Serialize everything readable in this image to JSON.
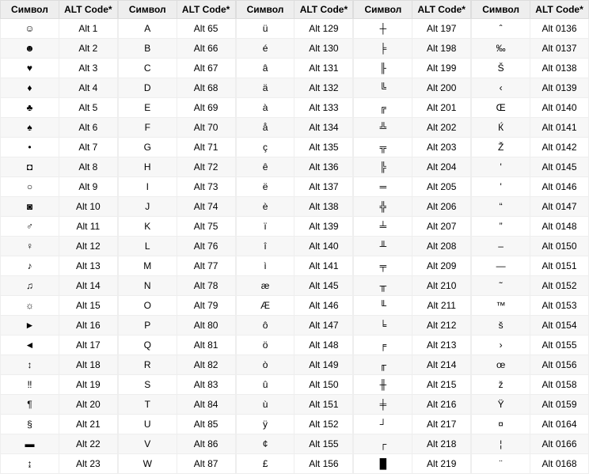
{
  "headers": {
    "symbol": "Символ",
    "code": "ALT Code*"
  },
  "columns": [
    [
      {
        "s": "☺",
        "c": "Alt 1"
      },
      {
        "s": "☻",
        "c": "Alt 2"
      },
      {
        "s": "♥",
        "c": "Alt 3"
      },
      {
        "s": "♦",
        "c": "Alt 4"
      },
      {
        "s": "♣",
        "c": "Alt 5"
      },
      {
        "s": "♠",
        "c": "Alt 6"
      },
      {
        "s": "•",
        "c": "Alt 7"
      },
      {
        "s": "◘",
        "c": "Alt 8"
      },
      {
        "s": "○",
        "c": "Alt 9"
      },
      {
        "s": "◙",
        "c": "Alt 10"
      },
      {
        "s": "♂",
        "c": "Alt 11"
      },
      {
        "s": "♀",
        "c": "Alt 12"
      },
      {
        "s": "♪",
        "c": "Alt 13"
      },
      {
        "s": "♫",
        "c": "Alt 14"
      },
      {
        "s": "☼",
        "c": "Alt 15"
      },
      {
        "s": "►",
        "c": "Alt 16"
      },
      {
        "s": "◄",
        "c": "Alt 17"
      },
      {
        "s": "↕",
        "c": "Alt 18"
      },
      {
        "s": "‼",
        "c": "Alt 19"
      },
      {
        "s": "¶",
        "c": "Alt 20"
      },
      {
        "s": "§",
        "c": "Alt 21"
      },
      {
        "s": "▬",
        "c": "Alt 22"
      },
      {
        "s": "↨",
        "c": "Alt 23"
      }
    ],
    [
      {
        "s": "A",
        "c": "Alt 65"
      },
      {
        "s": "B",
        "c": "Alt 66"
      },
      {
        "s": "C",
        "c": "Alt 67"
      },
      {
        "s": "D",
        "c": "Alt 68"
      },
      {
        "s": "E",
        "c": "Alt 69"
      },
      {
        "s": "F",
        "c": "Alt 70"
      },
      {
        "s": "G",
        "c": "Alt 71"
      },
      {
        "s": "H",
        "c": "Alt 72"
      },
      {
        "s": "I",
        "c": "Alt 73"
      },
      {
        "s": "J",
        "c": "Alt 74"
      },
      {
        "s": "K",
        "c": "Alt 75"
      },
      {
        "s": "L",
        "c": "Alt 76"
      },
      {
        "s": "M",
        "c": "Alt 77"
      },
      {
        "s": "N",
        "c": "Alt 78"
      },
      {
        "s": "O",
        "c": "Alt 79"
      },
      {
        "s": "P",
        "c": "Alt 80"
      },
      {
        "s": "Q",
        "c": "Alt 81"
      },
      {
        "s": "R",
        "c": "Alt 82"
      },
      {
        "s": "S",
        "c": "Alt 83"
      },
      {
        "s": "T",
        "c": "Alt 84"
      },
      {
        "s": "U",
        "c": "Alt 85"
      },
      {
        "s": "V",
        "c": "Alt 86"
      },
      {
        "s": "W",
        "c": "Alt 87"
      }
    ],
    [
      {
        "s": "ü",
        "c": "Alt 129"
      },
      {
        "s": "é",
        "c": "Alt 130"
      },
      {
        "s": "â",
        "c": "Alt 131"
      },
      {
        "s": "ä",
        "c": "Alt 132"
      },
      {
        "s": "à",
        "c": "Alt 133"
      },
      {
        "s": "å",
        "c": "Alt 134"
      },
      {
        "s": "ç",
        "c": "Alt 135"
      },
      {
        "s": "ê",
        "c": "Alt 136"
      },
      {
        "s": "ë",
        "c": "Alt 137"
      },
      {
        "s": "è",
        "c": "Alt 138"
      },
      {
        "s": "ï",
        "c": "Alt 139"
      },
      {
        "s": "î",
        "c": "Alt 140"
      },
      {
        "s": "ì",
        "c": "Alt 141"
      },
      {
        "s": "æ",
        "c": "Alt 145"
      },
      {
        "s": "Æ",
        "c": "Alt 146"
      },
      {
        "s": "ô",
        "c": "Alt 147"
      },
      {
        "s": "ö",
        "c": "Alt 148"
      },
      {
        "s": "ò",
        "c": "Alt 149"
      },
      {
        "s": "û",
        "c": "Alt 150"
      },
      {
        "s": "ù",
        "c": "Alt 151"
      },
      {
        "s": "ÿ",
        "c": "Alt 152"
      },
      {
        "s": "¢",
        "c": "Alt 155"
      },
      {
        "s": "£",
        "c": "Alt 156"
      }
    ],
    [
      {
        "s": "┼",
        "c": "Alt 197"
      },
      {
        "s": "╞",
        "c": "Alt 198"
      },
      {
        "s": "╟",
        "c": "Alt 199"
      },
      {
        "s": "╚",
        "c": "Alt 200"
      },
      {
        "s": "╔",
        "c": "Alt 201"
      },
      {
        "s": "╩",
        "c": "Alt 202"
      },
      {
        "s": "╦",
        "c": "Alt 203"
      },
      {
        "s": "╠",
        "c": "Alt 204"
      },
      {
        "s": "═",
        "c": "Alt 205"
      },
      {
        "s": "╬",
        "c": "Alt 206"
      },
      {
        "s": "╧",
        "c": "Alt 207"
      },
      {
        "s": "╨",
        "c": "Alt 208"
      },
      {
        "s": "╤",
        "c": "Alt 209"
      },
      {
        "s": "╥",
        "c": "Alt 210"
      },
      {
        "s": "╙",
        "c": "Alt 211"
      },
      {
        "s": "╘",
        "c": "Alt 212"
      },
      {
        "s": "╒",
        "c": "Alt 213"
      },
      {
        "s": "╓",
        "c": "Alt 214"
      },
      {
        "s": "╫",
        "c": "Alt 215"
      },
      {
        "s": "╪",
        "c": "Alt 216"
      },
      {
        "s": "┘",
        "c": "Alt 217"
      },
      {
        "s": "┌",
        "c": "Alt 218"
      },
      {
        "s": "█",
        "c": "Alt 219"
      }
    ],
    [
      {
        "s": "ˆ",
        "c": "Alt 0136"
      },
      {
        "s": "‰",
        "c": "Alt 0137"
      },
      {
        "s": "Š",
        "c": "Alt 0138"
      },
      {
        "s": "‹",
        "c": "Alt 0139"
      },
      {
        "s": "Œ",
        "c": "Alt 0140"
      },
      {
        "s": "Ќ",
        "c": "Alt 0141"
      },
      {
        "s": "Ž",
        "c": "Alt 0142"
      },
      {
        "s": "'",
        "c": "Alt 0145"
      },
      {
        "s": "'",
        "c": "Alt 0146"
      },
      {
        "s": "“",
        "c": "Alt 0147"
      },
      {
        "s": "”",
        "c": "Alt 0148"
      },
      {
        "s": "–",
        "c": "Alt 0150"
      },
      {
        "s": "—",
        "c": "Alt 0151"
      },
      {
        "s": "˜",
        "c": "Alt 0152"
      },
      {
        "s": "™",
        "c": "Alt 0153"
      },
      {
        "s": "š",
        "c": "Alt 0154"
      },
      {
        "s": "›",
        "c": "Alt 0155"
      },
      {
        "s": "œ",
        "c": "Alt 0156"
      },
      {
        "s": "ž",
        "c": "Alt 0158"
      },
      {
        "s": "Ÿ",
        "c": "Alt 0159"
      },
      {
        "s": "¤",
        "c": "Alt 0164"
      },
      {
        "s": "¦",
        "c": "Alt 0166"
      },
      {
        "s": "¨",
        "c": "Alt 0168"
      }
    ]
  ]
}
